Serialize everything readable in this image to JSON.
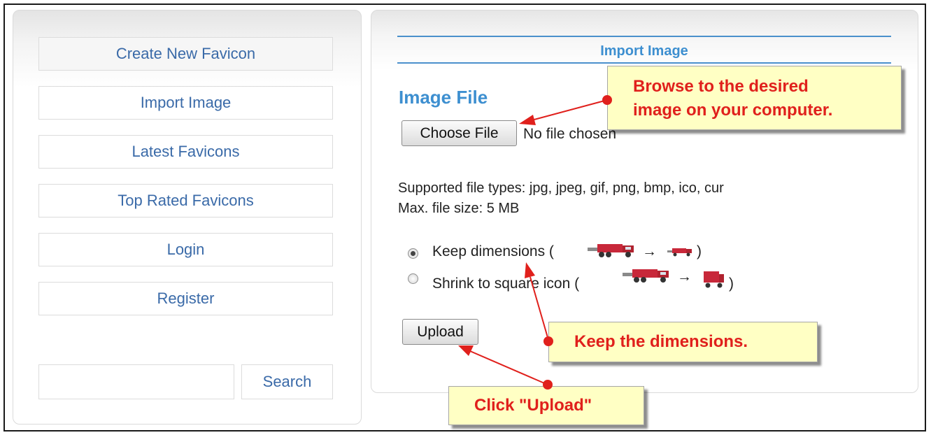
{
  "nav": {
    "create_new_favicon": "Create New Favicon",
    "import_image": "Import Image",
    "latest_favicons": "Latest Favicons",
    "top_rated_favicons": "Top Rated Favicons",
    "login": "Login",
    "register": "Register"
  },
  "search": {
    "input_value": "",
    "button_label": "Search"
  },
  "main": {
    "section_title": "Import Image",
    "image_file_heading": "Image File",
    "choose_file_label": "Choose File",
    "no_file_text": "No file chosen",
    "supported_types": "Supported file types: jpg, jpeg, gif, png, bmp, ico, cur",
    "max_size": "Max. file size: 5 MB",
    "option_keep": {
      "prefix": "Keep dimensions (",
      "suffix": ")",
      "checked": true
    },
    "option_shrink": {
      "prefix": "Shrink to square icon (",
      "suffix": ")",
      "checked": false
    },
    "arrow_glyph": "→",
    "upload_label": "Upload"
  },
  "callouts": {
    "browse_line1": "Browse to the desired",
    "browse_line2": "image on your computer.",
    "keep": "Keep the dimensions.",
    "upload": "Click \"Upload\""
  },
  "colors": {
    "link_blue": "#3a6aa8",
    "heading_blue": "#3d8fd0",
    "callout_red": "#e0201c",
    "callout_bg": "#ffffc4"
  },
  "icons": [
    "truck-large-icon",
    "truck-small-icon",
    "truck-square-icon",
    "red-dot-marker",
    "red-arrow"
  ]
}
